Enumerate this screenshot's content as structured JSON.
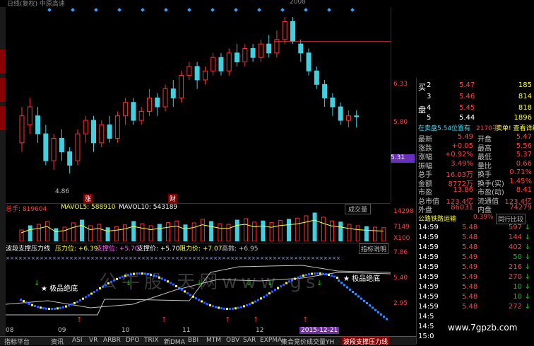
{
  "topbar": {
    "left_text": "日线(复权) 中原高速",
    "right_text": "2008"
  },
  "price_scale": {
    "ticks": [
      "6.33",
      "5.80",
      "5.31"
    ],
    "current_price": "5.31"
  },
  "main_labels": {
    "low_mark": "4.86",
    "high_mark": "6.33"
  },
  "event_markers": [
    "涨",
    "财"
  ],
  "volume_bar": {
    "total_label": "总手: 819604",
    "mavol5_label": "MAVOL5: 588910",
    "mavol10_label": "MAVOL10: 543189",
    "dropdown_label": "成交量"
  },
  "volume_scale": {
    "ticks": [
      "14298",
      "7149",
      "X100"
    ]
  },
  "indicator_bar": {
    "name": "波段支撑压力线",
    "pressure_label": "压力位: +6.39",
    "support_label": "支撑位: +5.70",
    "support_price": "支撑价: +5.70",
    "resist_price": "阻力价: +7.07",
    "high_sell": "高抛: +6.95",
    "help_button": "指标说明"
  },
  "indicator_scale": {
    "ticks": [
      "7.86",
      "5.40",
      "2.95"
    ]
  },
  "indicator_notes": {
    "left_star": "★ 极品绝底",
    "right_star": "★ 极品绝底"
  },
  "date_axis": {
    "labels": [
      "08",
      "09",
      "10",
      "11",
      "12"
    ],
    "highlight": "2015-12-21"
  },
  "bottom_tabs": [
    "指标平台",
    "资讯",
    "ASI",
    "VR",
    "ARBR",
    "DPO",
    "TRIX",
    "新DMA",
    "BBI",
    "MTM",
    "OBV",
    "SAR",
    "EXPMA",
    "集合竞价成交量YH",
    "波段支撑压力线"
  ],
  "order_book": [
    {
      "label": "买",
      "level": "2",
      "price": "5.47",
      "volume": "185"
    },
    {
      "label": "",
      "level": "3",
      "price": "5.46",
      "volume": "814"
    },
    {
      "label": "盘",
      "level": "4",
      "price": "5.45",
      "volume": "818"
    },
    {
      "label": "",
      "level": "5",
      "price": "5.44",
      "volume": "1896"
    }
  ],
  "sell_line": {
    "text": "在卖盘5.54位置有",
    "volume": "2170手",
    "action": "卖单! 查看详细"
  },
  "stats": [
    {
      "k1": "最新",
      "v1": "5.49",
      "k2": "开盘",
      "v2": "5.47"
    },
    {
      "k1": "涨跌",
      "v1": "+0.05",
      "k2": "最高",
      "v2": "5.56"
    },
    {
      "k1": "涨幅",
      "v1": "+0.92%",
      "k2": "最低",
      "v2": "5.37"
    },
    {
      "k1": "振幅",
      "v1": "3.49%",
      "k2": "量比",
      "v2": "0.66"
    },
    {
      "k1": "总手",
      "v1": "16.03万",
      "k2": "换手",
      "v2": "0.71%"
    },
    {
      "k1": "金额",
      "v1": "8772万",
      "k2": "换手(实)",
      "v2": "1.45%"
    },
    {
      "k1": "市盈",
      "v1": "13.86",
      "k2": "市盈(动)",
      "v2": "8.41"
    },
    {
      "k1": "总市值",
      "v1": "123.4亿",
      "k2": "流通值",
      "v2": "123.4亿"
    },
    {
      "k1": "外盘",
      "v1": "86031",
      "k2": "内盘",
      "v2": "74279"
    }
  ],
  "sector": {
    "name": "公路铁路运输",
    "change": "0.39%",
    "compare": "同行比较"
  },
  "ticks": [
    {
      "time": "14:59",
      "price": "5.48",
      "vol": "597"
    },
    {
      "time": "14:59",
      "price": "5.48",
      "vol": "144"
    },
    {
      "time": "14:59",
      "price": "5.48",
      "vol": "402"
    },
    {
      "time": "14:59",
      "price": "5.49",
      "vol": "50"
    },
    {
      "time": "14:59",
      "price": "5.49",
      "vol": "216"
    },
    {
      "time": "14:59",
      "price": "5.49",
      "vol": "270"
    },
    {
      "time": "14:59",
      "price": "5.48",
      "vol": "10"
    },
    {
      "time": "14:59",
      "price": "5.48",
      "vol": "10"
    },
    {
      "time": "14:59",
      "price": "5.48",
      "vol": "272"
    },
    {
      "time": "14:5",
      "price": "",
      "vol": ""
    },
    {
      "time": "14:5",
      "price": "",
      "vol": ""
    },
    {
      "time": "15:0",
      "price": "",
      "vol": ""
    }
  ],
  "watermark": "公牛股 天网www gs",
  "site_url": "www.7gpzb.com",
  "chart_data": {
    "type": "candlestick",
    "ylim": [
      4.6,
      6.6
    ],
    "candles": [
      [
        5.2,
        5.5,
        5.1,
        5.6
      ],
      [
        5.4,
        5.6,
        5.3,
        5.7
      ],
      [
        5.5,
        5.3,
        5.2,
        5.6
      ],
      [
        5.3,
        5.0,
        4.95,
        5.4
      ],
      [
        5.0,
        5.25,
        4.9,
        5.3
      ],
      [
        5.25,
        5.1,
        5.0,
        5.35
      ],
      [
        5.1,
        4.95,
        4.86,
        5.15
      ],
      [
        5.0,
        5.3,
        4.95,
        5.35
      ],
      [
        5.3,
        5.45,
        5.2,
        5.5
      ],
      [
        5.45,
        5.2,
        5.1,
        5.5
      ],
      [
        5.2,
        5.4,
        5.15,
        5.45
      ],
      [
        5.4,
        5.25,
        5.2,
        5.5
      ],
      [
        5.25,
        5.5,
        5.2,
        5.55
      ],
      [
        5.5,
        5.65,
        5.4,
        5.7
      ],
      [
        5.65,
        5.45,
        5.4,
        5.7
      ],
      [
        5.45,
        5.55,
        5.4,
        5.6
      ],
      [
        5.55,
        5.7,
        5.5,
        5.8
      ],
      [
        5.7,
        5.6,
        5.5,
        5.75
      ],
      [
        5.6,
        5.8,
        5.55,
        5.85
      ],
      [
        5.8,
        5.7,
        5.6,
        5.9
      ],
      [
        5.7,
        5.95,
        5.65,
        6.0
      ],
      [
        5.95,
        6.05,
        5.9,
        6.1
      ],
      [
        6.05,
        5.9,
        5.8,
        6.1
      ],
      [
        5.9,
        6.0,
        5.85,
        6.05
      ],
      [
        6.0,
        6.15,
        5.95,
        6.2
      ],
      [
        6.15,
        6.0,
        5.95,
        6.2
      ],
      [
        6.0,
        6.2,
        5.95,
        6.25
      ],
      [
        6.2,
        6.1,
        6.05,
        6.3
      ],
      [
        6.1,
        6.25,
        6.05,
        6.3
      ],
      [
        6.25,
        6.15,
        6.1,
        6.3
      ],
      [
        6.15,
        6.3,
        6.1,
        6.35
      ],
      [
        6.3,
        6.2,
        6.15,
        6.4
      ],
      [
        6.2,
        6.35,
        6.15,
        6.45
      ],
      [
        6.35,
        6.55,
        6.3,
        6.6
      ],
      [
        6.55,
        6.33,
        6.3,
        6.6
      ],
      [
        6.3,
        6.2,
        6.1,
        6.35
      ],
      [
        6.2,
        6.0,
        5.95,
        6.25
      ],
      [
        6.0,
        5.85,
        5.8,
        6.05
      ],
      [
        5.85,
        5.7,
        5.6,
        5.9
      ],
      [
        5.7,
        5.6,
        5.5,
        5.75
      ],
      [
        5.6,
        5.45,
        5.4,
        5.65
      ],
      [
        5.45,
        5.5,
        5.37,
        5.56
      ],
      [
        5.5,
        5.49,
        5.37,
        5.56
      ]
    ],
    "volumes": [
      40,
      55,
      60,
      70,
      45,
      50,
      65,
      75,
      55,
      60,
      48,
      52,
      58,
      70,
      62,
      55,
      60,
      66,
      72,
      58,
      65,
      78,
      70,
      62,
      60,
      75,
      80,
      68,
      72,
      66,
      74,
      78,
      82,
      90,
      100,
      85,
      72,
      68,
      60,
      55,
      52,
      50,
      48
    ]
  }
}
